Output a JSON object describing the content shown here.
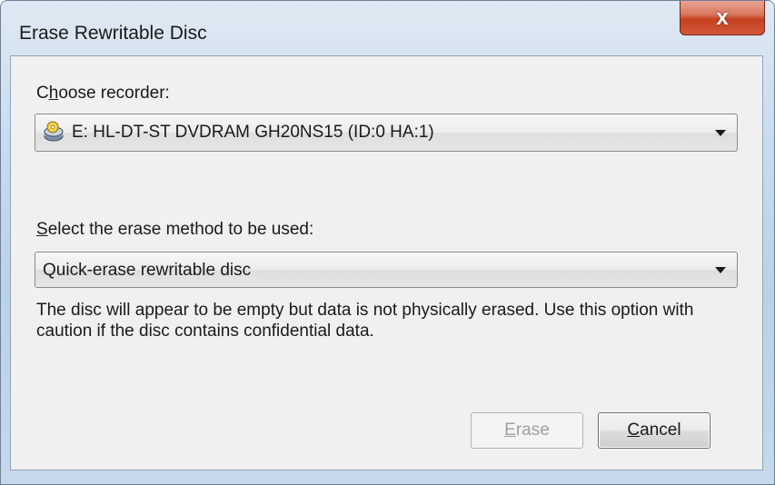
{
  "window": {
    "title": "Erase Rewritable Disc",
    "close_glyph": "x"
  },
  "recorder": {
    "label_mnemonic": "h",
    "label_pre": "C",
    "label_post": "oose recorder:",
    "selected": "E: HL-DT-ST DVDRAM GH20NS15  (ID:0 HA:1)",
    "icon": "optical-drive-icon"
  },
  "erase_method": {
    "label_mnemonic": "S",
    "label_post": "elect the erase method to be used:",
    "selected": "Quick-erase rewritable disc",
    "description": "The disc will appear to be empty but data is not physically erased. Use this option with caution if the disc contains confidential data."
  },
  "buttons": {
    "erase_mnemonic": "E",
    "erase_rest": "rase",
    "cancel_mnemonic": "C",
    "cancel_rest": "ancel"
  },
  "colors": {
    "close_button": "#c4401f",
    "dialog_background": "#f0f0f0",
    "frame": "#bcd1e6"
  }
}
